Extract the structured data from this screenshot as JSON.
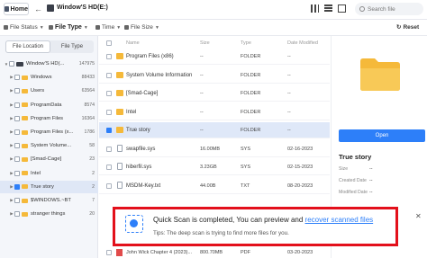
{
  "topbar": {
    "home_label": "Home",
    "disk_title": "Window'S HD(E:)",
    "search_placeholder": "Search file"
  },
  "filters": [
    {
      "label": "File Status"
    },
    {
      "label": "File Type"
    },
    {
      "label": "Time"
    },
    {
      "label": "File Size"
    }
  ],
  "reset_label": "Reset",
  "left_panel": {
    "tabs": [
      {
        "label": "File Location",
        "active": true
      },
      {
        "label": "File Type",
        "active": false
      }
    ],
    "tree": [
      {
        "name": "Window'S HD(...",
        "count": "147975",
        "checked": false,
        "indent": 0,
        "drive": true
      },
      {
        "name": "Windows",
        "count": "88433",
        "checked": false,
        "indent": 1
      },
      {
        "name": "Users",
        "count": "63564",
        "checked": false,
        "indent": 1
      },
      {
        "name": "ProgramData",
        "count": "8574",
        "checked": false,
        "indent": 1
      },
      {
        "name": "Program Files",
        "count": "16364",
        "checked": false,
        "indent": 1
      },
      {
        "name": "Program Files (x...",
        "count": "1786",
        "checked": false,
        "indent": 1
      },
      {
        "name": "System Volume...",
        "count": "58",
        "checked": false,
        "indent": 1
      },
      {
        "name": "[Smad-Cage]",
        "count": "23",
        "checked": false,
        "indent": 1
      },
      {
        "name": "Intel",
        "count": "2",
        "checked": false,
        "indent": 1
      },
      {
        "name": "True story",
        "count": "2",
        "checked": true,
        "indent": 1,
        "selected": true
      },
      {
        "name": "$WINDOWS.~BT",
        "count": "7",
        "checked": false,
        "indent": 1
      },
      {
        "name": "stranger things",
        "count": "20",
        "checked": false,
        "indent": 1
      }
    ]
  },
  "file_list": {
    "headers": {
      "name": "Name",
      "size": "Size",
      "type": "Type",
      "date": "Date Modified"
    },
    "rows": [
      {
        "name": "Program Files (x86)",
        "size": "--",
        "type": "FOLDER",
        "date": "--",
        "icon": "folder",
        "checked": false
      },
      {
        "name": "System Volume Information",
        "size": "--",
        "type": "FOLDER",
        "date": "--",
        "icon": "folder",
        "checked": false
      },
      {
        "name": "[Smad-Cage]",
        "size": "--",
        "type": "FOLDER",
        "date": "--",
        "icon": "folder",
        "checked": false
      },
      {
        "name": "Intel",
        "size": "--",
        "type": "FOLDER",
        "date": "--",
        "icon": "folder",
        "checked": false
      },
      {
        "name": "True story",
        "size": "--",
        "type": "FOLDER",
        "date": "--",
        "icon": "folder",
        "checked": true,
        "selected": true
      },
      {
        "name": "swapfile.sys",
        "size": "16.00MB",
        "type": "SYS",
        "date": "02-16-2023",
        "icon": "doc",
        "checked": false
      },
      {
        "name": "hiberfil.sys",
        "size": "3.23GB",
        "type": "SYS",
        "date": "02-15-2023",
        "icon": "doc",
        "checked": false
      },
      {
        "name": "MSDM-Key.txt",
        "size": "44.00B",
        "type": "TXT",
        "date": "08-20-2023",
        "icon": "doc",
        "checked": false
      }
    ],
    "tail_row": {
      "name": "John Wick Chapter 4 (2023)...",
      "size": "800.70MB",
      "type": "PDF",
      "date": "03-20-2023"
    }
  },
  "preview": {
    "open_label": "Open",
    "name": "True story",
    "fields": [
      {
        "label": "Size",
        "value": "--"
      },
      {
        "label": "Created Date",
        "value": "--"
      },
      {
        "label": "Modified Date",
        "value": "--"
      }
    ],
    "folder_color": "#f5b93a"
  },
  "toast": {
    "title_prefix": "Quick Scan is completed, You can preview and ",
    "title_link": "recover scanned files",
    "tip": "Tips: The deep scan is trying to find more files for you.",
    "border_color": "#e3101b",
    "link_color": "#2d7ff9"
  }
}
